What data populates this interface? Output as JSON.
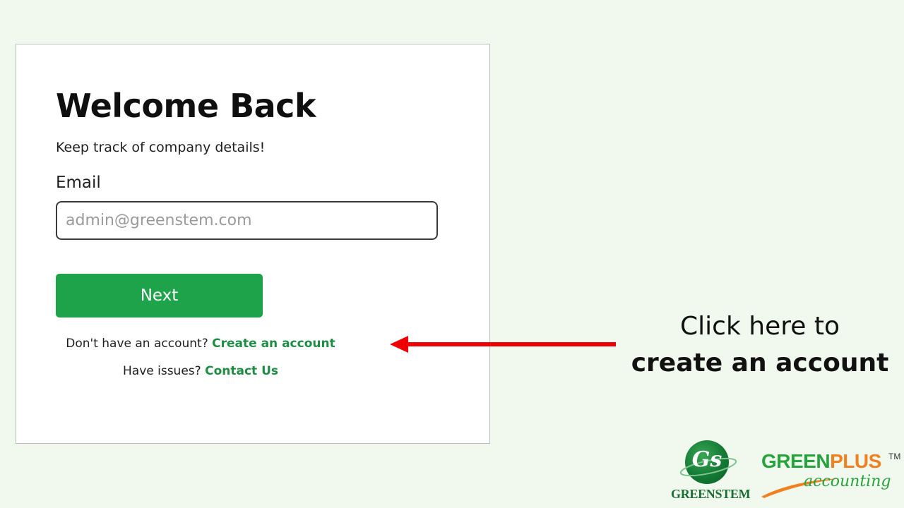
{
  "login": {
    "title": "Welcome Back",
    "subtitle": "Keep track of company details!",
    "email_label": "Email",
    "email_placeholder": "admin@greenstem.com",
    "email_value": "",
    "next_label": "Next",
    "create_prompt": "Don't have an account?",
    "create_link": "Create an account",
    "contact_prompt": "Have issues?",
    "contact_link": "Contact Us"
  },
  "callout": {
    "line1": "Click here to",
    "line2": "create an account",
    "arrow_color": "#ee0000"
  },
  "logos": {
    "greenstem_monogram": "Gs",
    "greenstem_name": "GREENSTEM",
    "greenplus_green": "GREEN",
    "greenplus_plus": "PLUS",
    "greenplus_tm": "TM",
    "greenplus_sub": "accounting"
  },
  "colors": {
    "background": "#f1f9ee",
    "accent": "#1ea34a",
    "link": "#1e8c45",
    "arrow": "#ee0000",
    "brand_orange": "#f08020"
  },
  "icons": {
    "arrow": "arrow-left-icon"
  }
}
